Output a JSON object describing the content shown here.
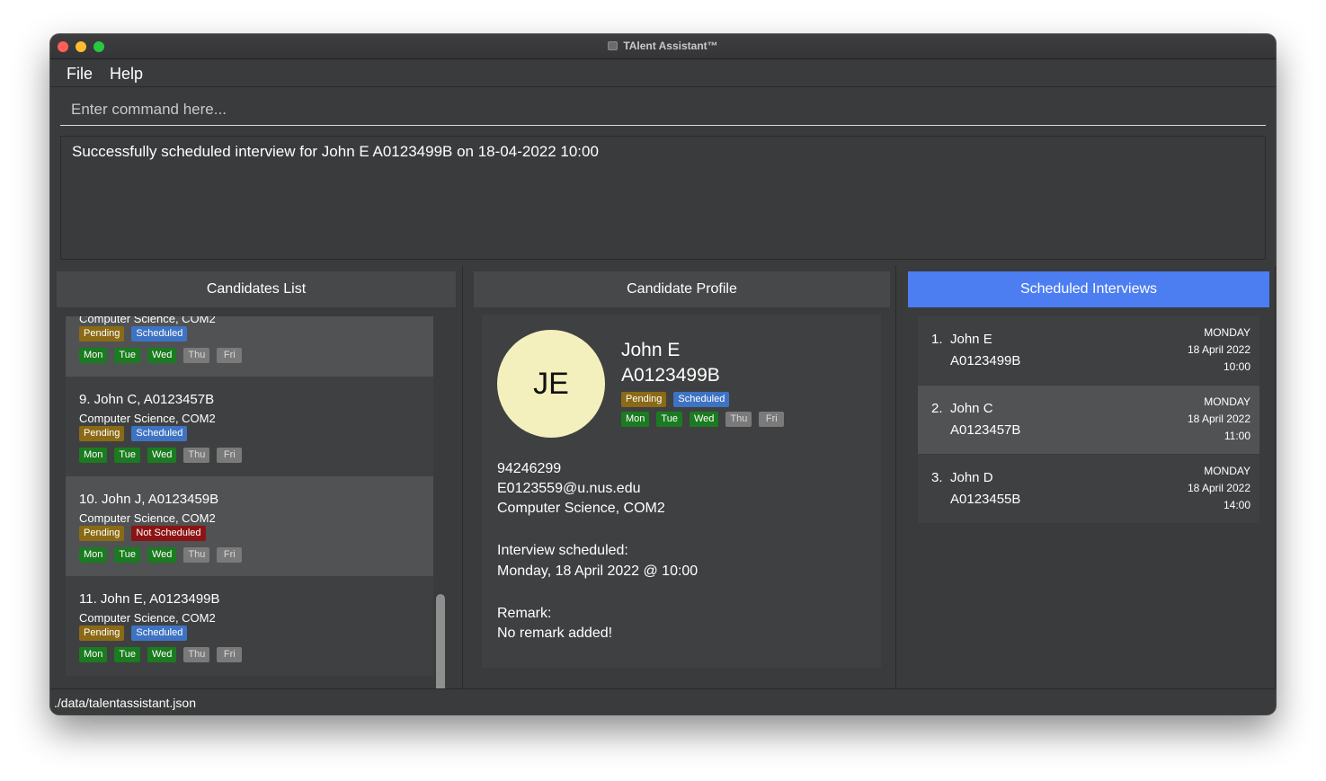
{
  "window": {
    "title": "TAlent Assistant™"
  },
  "menu": {
    "file": "File",
    "help": "Help"
  },
  "command": {
    "placeholder": "Enter command here..."
  },
  "result": {
    "message": "Successfully scheduled interview for John E A0123499B on 18-04-2022 10:00"
  },
  "panels": {
    "candidates": "Candidates List",
    "profile": "Candidate Profile",
    "interviews": "Scheduled Interviews"
  },
  "days": [
    "Mon",
    "Tue",
    "Wed",
    "Thu",
    "Fri"
  ],
  "candidates": [
    {
      "name": "",
      "course": "Computer Science, COM2",
      "status1": "Pending",
      "status2": "Scheduled",
      "availability": [
        1,
        1,
        1,
        0,
        0
      ]
    },
    {
      "name": "9.  John C, A0123457B",
      "course": "Computer Science, COM2",
      "status1": "Pending",
      "status2": "Scheduled",
      "availability": [
        1,
        1,
        1,
        0,
        0
      ]
    },
    {
      "name": "10.  John J, A0123459B",
      "course": "Computer Science, COM2",
      "status1": "Pending",
      "status2": "Not Scheduled",
      "availability": [
        1,
        1,
        1,
        0,
        0
      ]
    },
    {
      "name": "11.  John E, A0123499B",
      "course": "Computer Science, COM2",
      "status1": "Pending",
      "status2": "Scheduled",
      "availability": [
        1,
        1,
        1,
        0,
        0
      ]
    }
  ],
  "profile": {
    "initials": "JE",
    "name": "John E",
    "student_id": "A0123499B",
    "status1": "Pending",
    "status2": "Scheduled",
    "availability": [
      1,
      1,
      1,
      0,
      0
    ],
    "phone": "94246299",
    "email": "E0123559@u.nus.edu",
    "course": "Computer Science, COM2",
    "interview_label": "Interview scheduled:",
    "interview_value": "Monday, 18 April 2022  @ 10:00",
    "remark_label": "Remark:",
    "remark_value": "No remark added!"
  },
  "interviews": [
    {
      "index": "1.",
      "name": "John E",
      "id": "A0123499B",
      "day": "MONDAY",
      "date": "18 April 2022",
      "time": "10:00"
    },
    {
      "index": "2.",
      "name": "John C",
      "id": "A0123457B",
      "day": "MONDAY",
      "date": "18 April 2022",
      "time": "11:00"
    },
    {
      "index": "3.",
      "name": "John D",
      "id": "A0123455B",
      "day": "MONDAY",
      "date": "18 April 2022",
      "time": "14:00"
    }
  ],
  "status": {
    "file_path": "./data/talentassistant.json"
  }
}
